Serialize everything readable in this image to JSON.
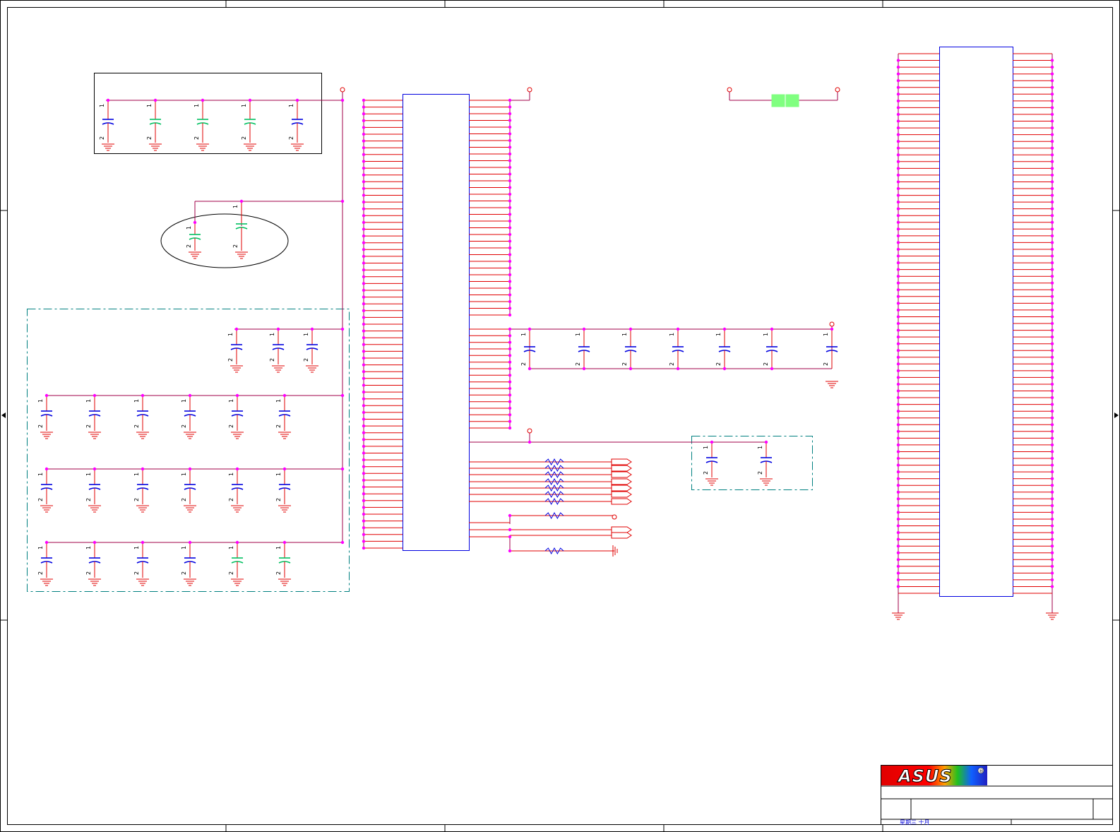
{
  "title_block": {
    "logo_text": "ASUS",
    "registered_mark": "®",
    "date_text": "星期三 十月"
  },
  "pin_labels": {
    "pin1": "1",
    "pin2": "2"
  },
  "colors": {
    "wire": "#e00000",
    "bus": "#a0004a",
    "junction": "#ff00ff",
    "component_outline": "#0000e0",
    "cap_blue": "#0000e0",
    "cap_green": "#00c060",
    "ground": "#e00000",
    "group_box": "#008080",
    "ferrite": "#80ff80"
  },
  "icons": {
    "capacitor": "capacitor-icon",
    "resistor": "resistor-icon",
    "ground": "ground-icon",
    "port": "port-arrow-icon",
    "power_node": "power-node-icon",
    "ferrite_bead": "ferrite-bead-icon"
  }
}
